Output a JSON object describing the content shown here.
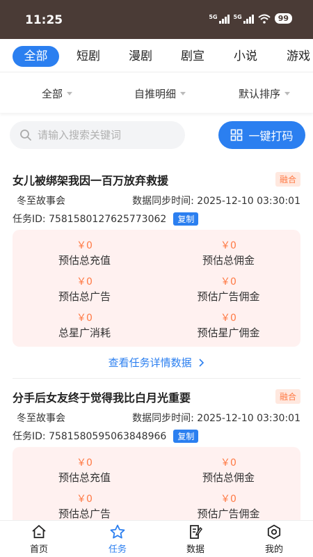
{
  "status": {
    "time": "11:25",
    "sig1": "5G",
    "sig2": "5G",
    "battery": "99"
  },
  "tabs": [
    {
      "label": "全部",
      "active": true
    },
    {
      "label": "短剧"
    },
    {
      "label": "漫剧"
    },
    {
      "label": "剧宣"
    },
    {
      "label": "小说"
    },
    {
      "label": "游戏"
    }
  ],
  "filters": {
    "all": "全部",
    "detail": "自推明细",
    "sort": "默认排序"
  },
  "search": {
    "placeholder": "请输入搜索关键词"
  },
  "actions": {
    "quick_code": "一键打码"
  },
  "tasks": [
    {
      "title": "女儿被绑架我因一百万放弃救援",
      "tag": "融合",
      "author": "冬至故事会",
      "sync": "数据同步时间:  2025-12-10 03:30:01",
      "task_id": "任务ID:  7581580127625773062",
      "copy": "复制",
      "stats": [
        {
          "value": "￥0",
          "label": "预估总充值"
        },
        {
          "value": "￥0",
          "label": "预估总佣金"
        },
        {
          "value": "￥0",
          "label": "预估总广告"
        },
        {
          "value": "￥0",
          "label": "预估广告佣金"
        },
        {
          "value": "￥0",
          "label": "总星广消耗"
        },
        {
          "value": "￥0",
          "label": "预估星广佣金"
        }
      ],
      "detail_link": "查看任务详情数据"
    },
    {
      "title": "分手后女友终于觉得我比白月光重要",
      "tag": "融合",
      "author": "冬至故事会",
      "sync": "数据同步时间:  2025-12-10 03:30:01",
      "task_id": "任务ID:  7581580595063848966",
      "copy": "复制",
      "stats": [
        {
          "value": "￥0",
          "label": "预估总充值"
        },
        {
          "value": "￥0",
          "label": "预估总佣金"
        },
        {
          "value": "￥0",
          "label": "预估总广告"
        },
        {
          "value": "￥0",
          "label": "预估广告佣金"
        }
      ]
    }
  ],
  "bottom_nav": [
    {
      "label": "首页",
      "icon": "home-icon"
    },
    {
      "label": "任务",
      "icon": "star-icon",
      "active": true
    },
    {
      "label": "数据",
      "icon": "document-edit-icon"
    },
    {
      "label": "我的",
      "icon": "gear-icon"
    }
  ],
  "colors": {
    "primary": "#2b7ff0",
    "accent": "#ff7a45",
    "stat_bg": "#fff1f0",
    "status_bar": "#4a3b36"
  }
}
